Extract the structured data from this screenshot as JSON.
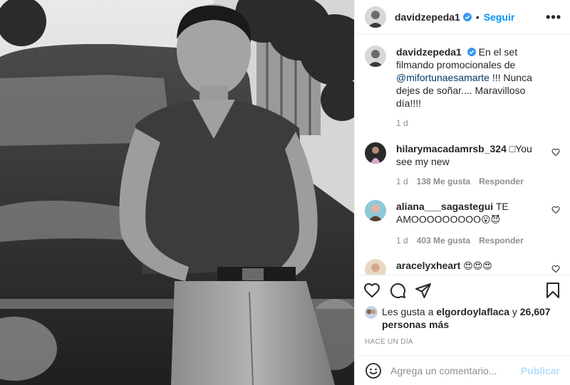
{
  "header": {
    "username": "davidzepeda1",
    "separator": "•",
    "follow_label": "Seguir",
    "more_label": "•••"
  },
  "caption": {
    "username": "davidzepeda1",
    "text_before": "En el set filmando promocionales de ",
    "mention": "@mifortunaesamarte",
    "text_after": " !!! Nunca dejes de soñar.... Maravilloso día!!!!",
    "time": "1 d"
  },
  "comments": [
    {
      "username": "hilarymacadamrsb_324",
      "text": "□You see my new",
      "time": "1 d",
      "likes": "138 Me gusta",
      "reply_label": "Responder"
    },
    {
      "username": "aliana___sagastegui",
      "text": "TE AMOOOOOOOOO",
      "emojis": "😮😈",
      "time": "1 d",
      "likes": "403 Me gusta",
      "reply_label": "Responder"
    },
    {
      "username": "aracelyxheart",
      "text": "",
      "emojis": "😍😍😍"
    }
  ],
  "likes": {
    "prefix": "Les gusta a ",
    "user": "elgordoylaflaca",
    "middle": " y ",
    "count": "26,607 personas más"
  },
  "timestamp": "HACE UN DÍA",
  "add_comment": {
    "placeholder": "Agrega un comentario...",
    "publish_label": "Publicar"
  },
  "colors": {
    "accent": "#0095f6",
    "text": "#262626",
    "muted": "#8e8e8e",
    "publish_disabled": "#b2dffc",
    "verified": "#3897f0"
  },
  "icons": [
    "verified-badge-icon",
    "heart-icon",
    "comment-icon",
    "share-icon",
    "bookmark-icon",
    "emoji-icon"
  ]
}
